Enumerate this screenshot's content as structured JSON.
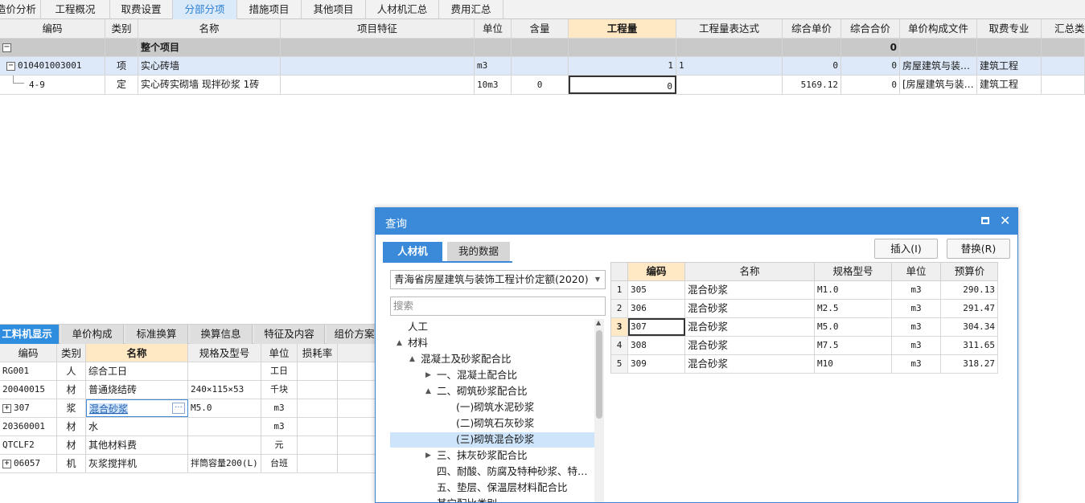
{
  "top_tabs": [
    {
      "label": "造价分析",
      "active": false
    },
    {
      "label": "工程概况",
      "active": false
    },
    {
      "label": "取费设置",
      "active": false
    },
    {
      "label": "分部分项",
      "active": true
    },
    {
      "label": "措施项目",
      "active": false
    },
    {
      "label": "其他项目",
      "active": false
    },
    {
      "label": "人材机汇总",
      "active": false
    },
    {
      "label": "费用汇总",
      "active": false
    }
  ],
  "main_table": {
    "headers": [
      "编码",
      "类别",
      "名称",
      "项目特征",
      "单位",
      "含量",
      "工程量",
      "工程量表达式",
      "综合单价",
      "综合合价",
      "单价构成文件",
      "取费专业",
      "汇总类别"
    ],
    "group_row": {
      "toggle": "−",
      "name": "整个项目",
      "total": "0"
    },
    "rows": [
      {
        "toggle": "−",
        "code": "010401003001",
        "type": "项",
        "name": "实心砖墙",
        "feature": "",
        "unit": "m3",
        "content": "",
        "qty": "1",
        "expr": "1",
        "unit_price": "0",
        "total": "0",
        "price_file": "房屋建筑与装…",
        "fee_major": "建筑工程",
        "summary": ""
      },
      {
        "toggle": "",
        "code": "4-9",
        "type": "定",
        "name": "实心砖实砌墙 现拌砂浆 1砖",
        "feature": "",
        "unit": "10m3",
        "content": "0",
        "qty": "0",
        "expr": "",
        "unit_price": "5169.12",
        "total": "0",
        "price_file": "[房屋建筑与装…",
        "fee_major": "建筑工程",
        "summary": ""
      }
    ]
  },
  "bottom_tabs": [
    {
      "label": "工料机显示",
      "active": true
    },
    {
      "label": "单价构成",
      "active": false
    },
    {
      "label": "标准换算",
      "active": false
    },
    {
      "label": "换算信息",
      "active": false
    },
    {
      "label": "特征及内容",
      "active": false
    },
    {
      "label": "组价方案",
      "active": false
    }
  ],
  "bottom_table": {
    "headers": [
      "编码",
      "类别",
      "名称",
      "规格及型号",
      "单位",
      "损耗率"
    ],
    "rows": [
      {
        "toggle": "",
        "code": "RG001",
        "type": "人",
        "name": "综合工日",
        "spec": "",
        "unit": "工日",
        "loss": ""
      },
      {
        "toggle": "",
        "code": "20040015",
        "type": "材",
        "name": "普通烧结砖",
        "spec": "240×115×53",
        "unit": "千块",
        "loss": ""
      },
      {
        "toggle": "+",
        "code": "307",
        "type": "浆",
        "name": "混合砂浆",
        "spec": "M5.0",
        "unit": "m3",
        "loss": "",
        "editing": true,
        "ellipsis": "···"
      },
      {
        "toggle": "",
        "code": "20360001",
        "type": "材",
        "name": "水",
        "spec": "",
        "unit": "m3",
        "loss": ""
      },
      {
        "toggle": "",
        "code": "QTCLF2",
        "type": "材",
        "name": "其他材料费",
        "spec": "",
        "unit": "元",
        "loss": ""
      },
      {
        "toggle": "+",
        "code": "06057",
        "type": "机",
        "name": "灰浆搅拌机",
        "spec": "拌筒容量200(L)",
        "unit": "台班",
        "loss": ""
      }
    ]
  },
  "dialog": {
    "title": "查询",
    "tabs": [
      {
        "label": "人材机",
        "active": true
      },
      {
        "label": "我的数据",
        "active": false
      }
    ],
    "insert_button": "插入(I)",
    "replace_button": "替换(R)",
    "quota_select": "青海省房屋建筑与装饰工程计价定额(2020)",
    "search_placeholder": "搜索",
    "tree": [
      {
        "label": "人工",
        "level": 0,
        "arrow": "",
        "selected": false
      },
      {
        "label": "材料",
        "level": 0,
        "arrow": "▲",
        "selected": false
      },
      {
        "label": "混凝土及砂浆配合比",
        "level": 1,
        "arrow": "▲",
        "selected": false
      },
      {
        "label": "一、混凝土配合比",
        "level": 2,
        "arrow": "▶",
        "selected": false
      },
      {
        "label": "二、砌筑砂浆配合比",
        "level": 2,
        "arrow": "▲",
        "selected": false
      },
      {
        "label": "(一)砌筑水泥砂浆",
        "level": 3,
        "arrow": "",
        "selected": false
      },
      {
        "label": "(二)砌筑石灰砂浆",
        "level": 3,
        "arrow": "",
        "selected": false
      },
      {
        "label": "(三)砌筑混合砂浆",
        "level": 3,
        "arrow": "",
        "selected": true
      },
      {
        "label": "三、抹灰砂浆配合比",
        "level": 2,
        "arrow": "▶",
        "selected": false
      },
      {
        "label": "四、耐酸、防腐及特种砂浆、特…",
        "level": 2,
        "arrow": "",
        "selected": false
      },
      {
        "label": "五、垫层、保温层材料配合比",
        "level": 2,
        "arrow": "",
        "selected": false
      },
      {
        "label": "其它配比类别",
        "level": 2,
        "arrow": "",
        "selected": false
      }
    ],
    "result_headers": [
      "编码",
      "名称",
      "规格型号",
      "单位",
      "预算价"
    ],
    "results": [
      {
        "index": "1",
        "code": "305",
        "name": "混合砂浆",
        "spec": "M1.0",
        "unit": "m3",
        "price": "290.13"
      },
      {
        "index": "2",
        "code": "306",
        "name": "混合砂浆",
        "spec": "M2.5",
        "unit": "m3",
        "price": "291.47"
      },
      {
        "index": "3",
        "code": "307",
        "name": "混合砂浆",
        "spec": "M5.0",
        "unit": "m3",
        "price": "304.34"
      },
      {
        "index": "4",
        "code": "308",
        "name": "混合砂浆",
        "spec": "M7.5",
        "unit": "m3",
        "price": "311.65"
      },
      {
        "index": "5",
        "code": "309",
        "name": "混合砂浆",
        "spec": "M10",
        "unit": "m3",
        "price": "318.27"
      }
    ]
  }
}
